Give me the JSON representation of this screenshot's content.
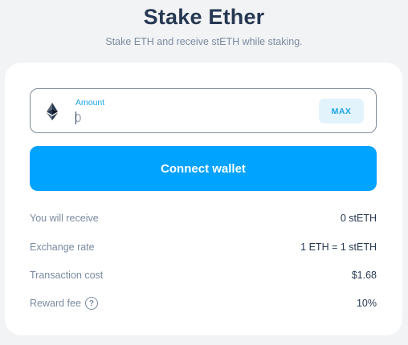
{
  "header": {
    "title": "Stake Ether",
    "subtitle": "Stake ETH and receive stETH while staking."
  },
  "stake_form": {
    "amount_label": "Amount",
    "amount_placeholder": "0",
    "max_label": "MAX",
    "connect_label": "Connect wallet",
    "token_icon": "ethereum-icon"
  },
  "info": {
    "rows": [
      {
        "label": "You will receive",
        "value": "0 stETH"
      },
      {
        "label": "Exchange rate",
        "value": "1 ETH = 1 stETH"
      },
      {
        "label": "Transaction cost",
        "value": "$1.68"
      },
      {
        "label": "Reward fee",
        "value": "10%",
        "help_symbol": "?"
      }
    ]
  },
  "colors": {
    "accent": "#00a3ff",
    "title": "#273852",
    "muted": "#7a8aa0",
    "background": "#f2f3f5"
  }
}
